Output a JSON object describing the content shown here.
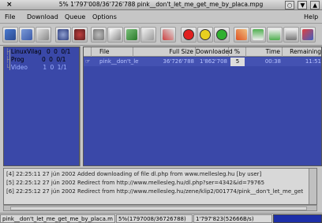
{
  "window": {
    "title": "5% 1'797'008/36'726'788 pink__don't_let_me_get_me_by_placa.mpg",
    "close_glyph": "×",
    "buttons": [
      "○",
      "▼",
      "▲"
    ]
  },
  "menu": {
    "file": "File",
    "download": "Download",
    "queue": "Queue",
    "options": "Options",
    "help": "Help"
  },
  "toolbar": {
    "icons": [
      "new-icon",
      "open-icon",
      "save-icon",
      "settings-icon",
      "delete-icon",
      "gear-icon",
      "users-icon",
      "pause-icon",
      "resume-icon",
      "tools-icon"
    ],
    "lights": [
      {
        "name": "red-light",
        "color": "#e02020"
      },
      {
        "name": "yellow-light",
        "color": "#e8d020"
      },
      {
        "name": "green-light",
        "color": "#30b030"
      }
    ],
    "icons2": [
      "pencil-icon",
      "move-up-icon",
      "move-down-icon",
      "terminal-icon",
      "exit-icon"
    ]
  },
  "tree": [
    {
      "label": "LinuxVilag",
      "n1": "0",
      "n2": "0",
      "n3": "0/1"
    },
    {
      "label": "Prog",
      "n1": "0",
      "n2": "0",
      "n3": "0/1"
    },
    {
      "label": "Video",
      "n1": "1",
      "n2": "0",
      "n3": "1/1"
    }
  ],
  "table": {
    "headers": [
      "",
      "File",
      "Full Size",
      "Downloaded",
      "%",
      "Time",
      "Remaining"
    ],
    "rows": [
      {
        "file": "pink__don't_let",
        "full_size": "36'726'788",
        "downloaded": "1'862'708",
        "percent": "5",
        "time": "00:38",
        "remaining": "11:51"
      }
    ]
  },
  "log": [
    "[4]  22:25:11  27 jún 2002  Added downloading of file dl.php from www.mellesleg.hu [by user]",
    "[5]  22:25:12  27 jún 2002  Redirect from http://www.mellesleg.hu/dl.php?ser=4342&id=79765",
    "[6]  22:25:12  27 jún 2002  Redirect from http://www.mellesleg.hu/zene/klip2/001774/pink__don't_let_me_get"
  ],
  "status": {
    "file": "pink__don't_let_me_get_me_by_placa.m",
    "progress": "5%(1797008/36726788)",
    "speed": "1'797'823(52666B/s)"
  }
}
